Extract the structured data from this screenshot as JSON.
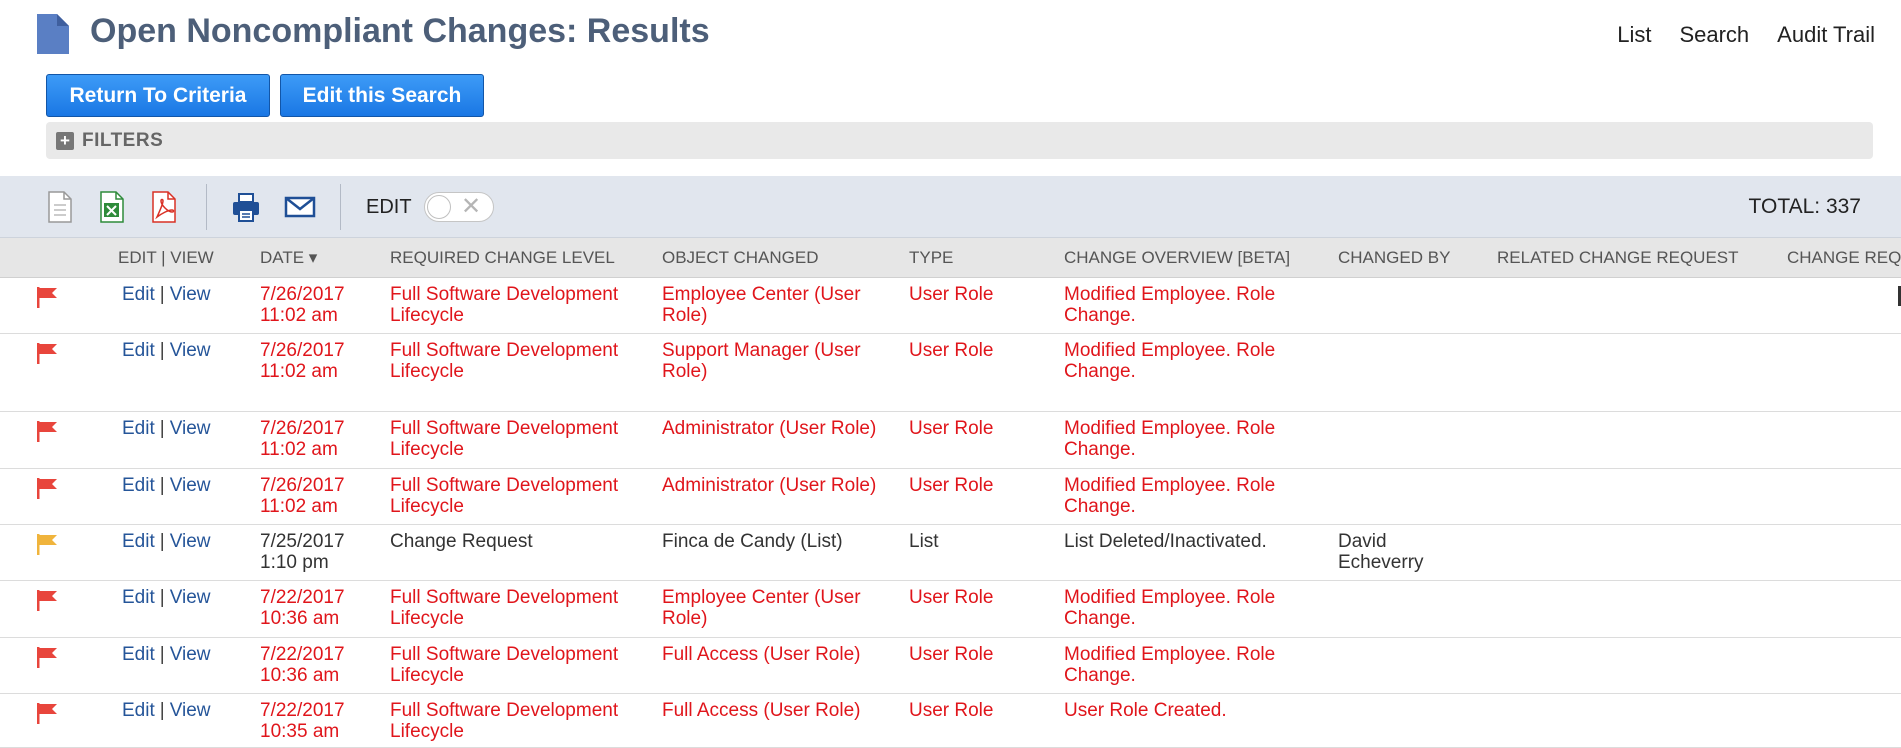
{
  "header": {
    "title": "Open Noncompliant Changes: Results",
    "nav": [
      "List",
      "Search",
      "Audit Trail"
    ]
  },
  "buttons": {
    "return_label": "Return To Criteria",
    "edit_search_label": "Edit this Search"
  },
  "filters": {
    "label": "FILTERS"
  },
  "toolbar": {
    "icons": [
      "document-icon",
      "excel-icon",
      "pdf-icon",
      "print-icon",
      "email-icon"
    ],
    "edit_label": "EDIT",
    "edit_toggle_on": false,
    "total": "TOTAL: 337"
  },
  "table": {
    "columns": {
      "edit_view": "EDIT | VIEW",
      "date": "DATE ▾",
      "required_level": "REQUIRED CHANGE LEVEL",
      "object_changed": "OBJECT CHANGED",
      "type": "TYPE",
      "overview": "CHANGE OVERVIEW [BETA]",
      "changed_by": "CHANGED BY",
      "related_request": "RELATED CHANGE REQUEST",
      "change_req": "CHANGE REQ"
    },
    "edit_text": "Edit",
    "view_text": "View",
    "separator": "|",
    "rows": [
      {
        "flag": "red",
        "date": "7/26/2017",
        "time": "11:02 am",
        "level": "Full Software Development Lifecycle",
        "object": "Employee Center (User Role)",
        "type": "User Role",
        "overview": "Modified Employee. Role Change.",
        "changed_by": ""
      },
      {
        "flag": "red",
        "date": "7/26/2017",
        "time": "11:02 am",
        "level": "Full Software Development Lifecycle",
        "object": "Support Manager (User Role)",
        "type": "User Role",
        "overview": "Modified Employee. Role Change.",
        "changed_by": ""
      },
      {
        "flag": "red",
        "date": "7/26/2017",
        "time": "11:02 am",
        "level": "Full Software Development Lifecycle",
        "object": "Administrator (User Role)",
        "type": "User Role",
        "overview": "Modified Employee. Role Change.",
        "changed_by": ""
      },
      {
        "flag": "red",
        "date": "7/26/2017",
        "time": "11:02 am",
        "level": "Full Software Development Lifecycle",
        "object": "Administrator (User Role)",
        "type": "User Role",
        "overview": "Modified Employee. Role Change.",
        "changed_by": ""
      },
      {
        "flag": "yellow",
        "date": "7/25/2017",
        "time": "1:10 pm",
        "level": "Change Request",
        "object": "Finca de Candy (List)",
        "type": "List",
        "overview": "List Deleted/Inactivated.",
        "changed_by": "David Echeverry"
      },
      {
        "flag": "red",
        "date": "7/22/2017",
        "time": "10:36 am",
        "level": "Full Software Development Lifecycle",
        "object": "Employee Center (User Role)",
        "type": "User Role",
        "overview": "Modified Employee. Role Change.",
        "changed_by": ""
      },
      {
        "flag": "red",
        "date": "7/22/2017",
        "time": "10:36 am",
        "level": "Full Software Development Lifecycle",
        "object": "Full Access (User Role)",
        "type": "User Role",
        "overview": "Modified Employee. Role Change.",
        "changed_by": ""
      },
      {
        "flag": "red",
        "date": "7/22/2017",
        "time": "10:35 am",
        "level": "Full Software Development Lifecycle",
        "object": "Full Access (User Role)",
        "type": "User Role",
        "overview": "User Role Created.",
        "changed_by": ""
      }
    ]
  },
  "colors": {
    "title": "#4d5f79",
    "button": "#1a77e4",
    "noncompliant_text": "#e0151b",
    "flag_red": "#e8453c",
    "flag_yellow": "#f0b43c",
    "link": "#255599"
  }
}
